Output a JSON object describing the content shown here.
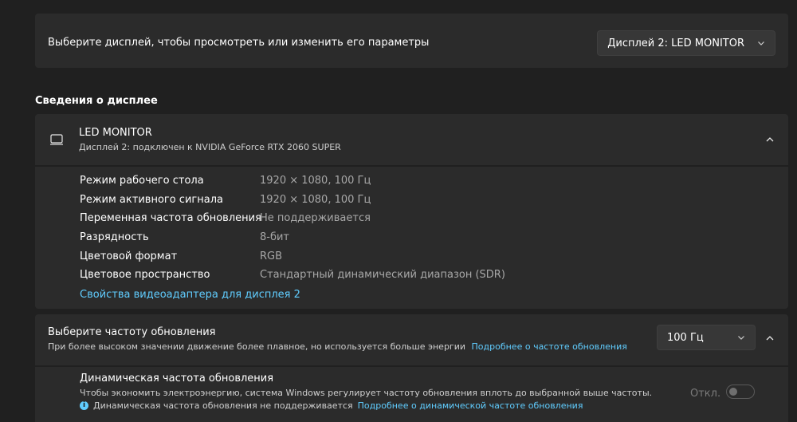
{
  "display_select": {
    "label": "Выберите дисплей, чтобы просмотреть или изменить его параметры",
    "selected": "Дисплей 2: LED MONITOR"
  },
  "section_title": "Сведения о дисплее",
  "display_info": {
    "name": "LED MONITOR",
    "subtitle": "Дисплей 2: подключен к NVIDIA GeForce RTX 2060 SUPER",
    "rows": [
      {
        "key": "Режим рабочего стола",
        "value": "1920 × 1080, 100 Гц"
      },
      {
        "key": "Режим активного сигнала",
        "value": "1920 × 1080, 100 Гц"
      },
      {
        "key": "Переменная частота обновления",
        "value": "Не поддерживается"
      },
      {
        "key": "Разрядность",
        "value": "8-бит"
      },
      {
        "key": "Цветовой формат",
        "value": "RGB"
      },
      {
        "key": "Цветовое пространство",
        "value": "Стандартный динамический диапазон (SDR)"
      }
    ],
    "adapter_link": "Свойства видеоадаптера для дисплея 2"
  },
  "refresh_rate": {
    "title": "Выберите частоту обновления",
    "description": "При более высоком значении движение более плавное, но используется больше энергии",
    "learn_more": "Подробнее о частоте обновления",
    "selected": "100 Гц"
  },
  "dynamic_refresh": {
    "title": "Динамическая частота обновления",
    "description": "Чтобы экономить электроэнергию, система Windows регулирует частоту обновления вплоть до выбранной выше частоты.",
    "note": "Динамическая частота обновления не поддерживается",
    "note_link": "Подробнее о динамической частоте обновления",
    "toggle_label": "Откл.",
    "toggle_on": false
  },
  "colors": {
    "background": "#202020",
    "card": "#2b2b2b",
    "accent": "#60cdff"
  },
  "icons": [
    "chevron-down-icon",
    "monitor-icon",
    "chevron-up-icon",
    "info-icon"
  ]
}
